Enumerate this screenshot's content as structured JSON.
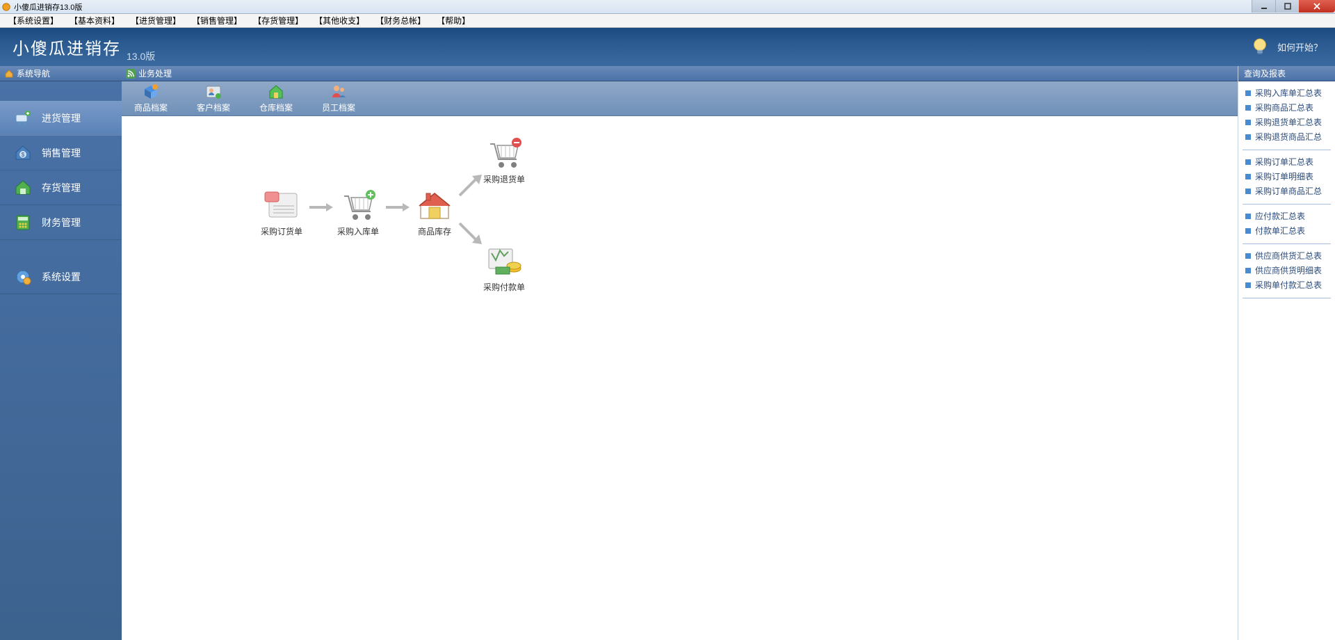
{
  "window": {
    "title": "小傻瓜进销存13.0版"
  },
  "menubar": [
    "【系统设置】",
    "【基本资料】",
    "【进货管理】",
    "【销售管理】",
    "【存货管理】",
    "【其他收支】",
    "【财务总帐】",
    "【帮助】"
  ],
  "header": {
    "app_name": "小傻瓜进销存",
    "version": "13.0版",
    "howto": "如何开始？"
  },
  "sidebar": {
    "title": "系统导航",
    "items": [
      {
        "label": "进货管理"
      },
      {
        "label": "销售管理"
      },
      {
        "label": "存货管理"
      },
      {
        "label": "财务管理"
      },
      {
        "label": "系统设置"
      }
    ]
  },
  "main": {
    "title": "业务处理",
    "toolbar": [
      {
        "label": "商品档案"
      },
      {
        "label": "客户档案"
      },
      {
        "label": "仓库档案"
      },
      {
        "label": "员工档案"
      }
    ],
    "flow": {
      "po": "采购订货单",
      "pi": "采购入库单",
      "inv": "商品库存",
      "ret": "采购退货单",
      "pay": "采购付款单"
    }
  },
  "rightbar": {
    "title": "查询及报表",
    "groups": [
      [
        "采购入库单汇总表",
        "采购商品汇总表",
        "采购退货单汇总表",
        "采购退货商品汇总"
      ],
      [
        "采购订单汇总表",
        "采购订单明细表",
        "采购订单商品汇总"
      ],
      [
        "应付款汇总表",
        "付款单汇总表"
      ],
      [
        "供应商供货汇总表",
        "供应商供货明细表",
        "采购单付款汇总表"
      ]
    ]
  }
}
